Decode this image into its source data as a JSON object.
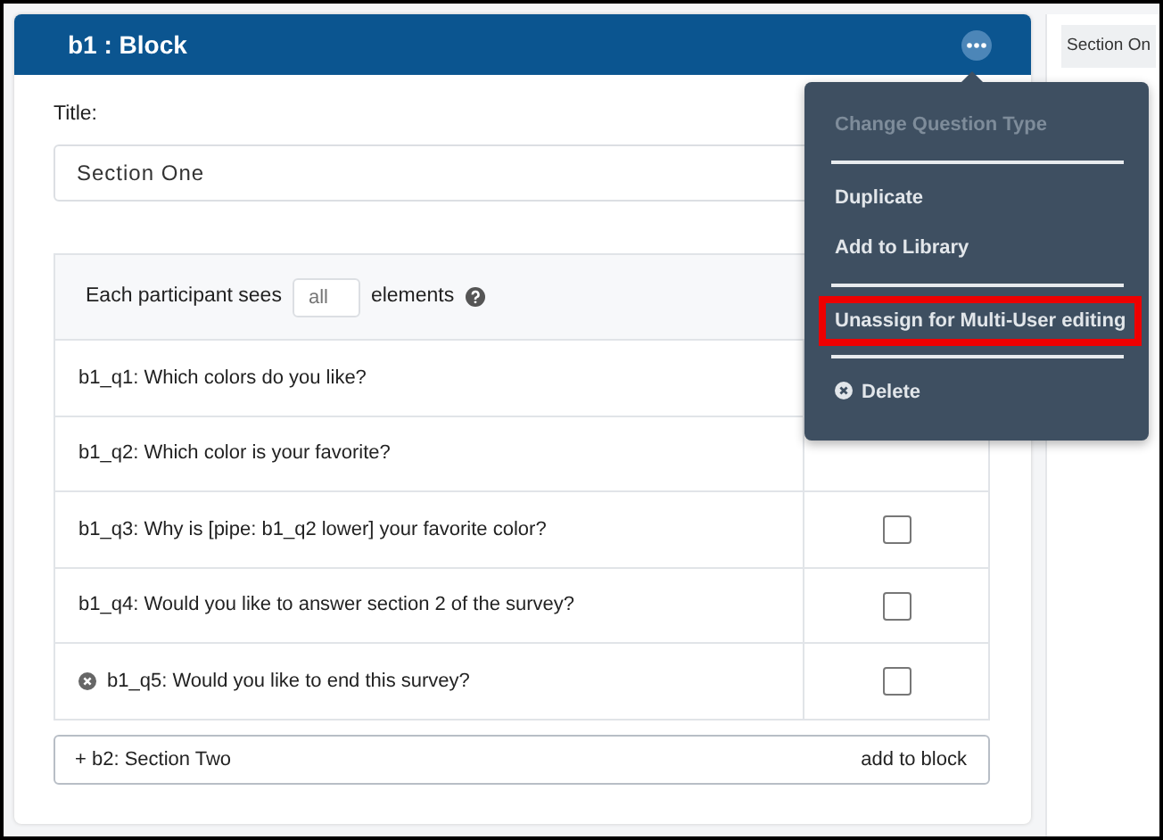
{
  "block": {
    "title": "b1 : Block",
    "title_label": "Title:",
    "title_value": "Section One",
    "participant_prefix": "Each participant sees",
    "participant_placeholder": "all",
    "participant_suffix": "elements",
    "questions": [
      {
        "text": "b1_q1: Which colors do you like?",
        "removable": false
      },
      {
        "text": "b1_q2: Which color is your favorite?",
        "removable": false
      },
      {
        "text": "b1_q3: Why is [pipe: b1_q2 lower] your favorite color?",
        "removable": false,
        "checked": false
      },
      {
        "text": "b1_q4: Would you like to answer section 2 of the survey?",
        "removable": false,
        "checked": false
      },
      {
        "text": "b1_q5: Would you like to end this survey?",
        "removable": true,
        "checked": false
      }
    ],
    "next_block": {
      "symbol": "+",
      "label": "b2: Section Two",
      "action": "add to block"
    }
  },
  "menu": [
    {
      "kind": "item",
      "label": "Change Question Type",
      "disabled": true,
      "highlighted": false
    },
    {
      "kind": "divider"
    },
    {
      "kind": "item",
      "label": "Duplicate",
      "disabled": false,
      "highlighted": false
    },
    {
      "kind": "item",
      "label": "Add to Library",
      "disabled": false,
      "highlighted": false
    },
    {
      "kind": "divider"
    },
    {
      "kind": "item",
      "label": "Unassign for Multi-User editing",
      "disabled": false,
      "highlighted": true
    },
    {
      "kind": "divider"
    },
    {
      "kind": "delete",
      "label": "Delete",
      "disabled": false,
      "highlighted": false
    }
  ],
  "side_panel": {
    "chip": "Section On"
  }
}
